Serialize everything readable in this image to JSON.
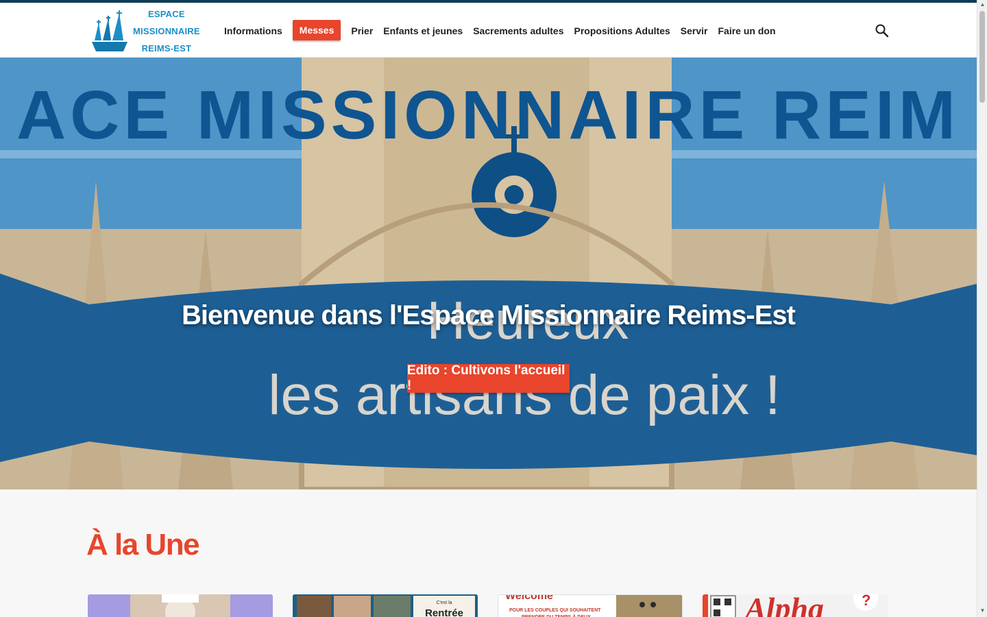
{
  "header": {
    "logo": {
      "line1": "ESPACE",
      "line2": "MISSIONNAIRE",
      "line3": "REIMS-EST"
    },
    "nav": [
      {
        "label": "Informations"
      },
      {
        "label": "Messes",
        "highlight": true
      },
      {
        "label": "Prier"
      },
      {
        "label": "Enfants et jeunes"
      },
      {
        "label": "Sacrements adultes"
      },
      {
        "label": "Propositions Adultes"
      },
      {
        "label": "Servir"
      },
      {
        "label": "Faire un don"
      }
    ],
    "search_icon": "search-icon"
  },
  "hero": {
    "banner_text": "ACE MISSIONNAIRE REIM",
    "ribbon_text_1": "Heureux",
    "ribbon_text_2": "les artisans de paix !",
    "title": "Bienvenue dans l'Espace Missionnaire Reims-Est",
    "button": "Edito : Cultivons l'accueil !"
  },
  "section": {
    "title": "À la Une"
  },
  "cards": [
    {
      "caption": ""
    },
    {
      "caption": "C'est la Rentrée"
    },
    {
      "caption": "Welcome — POUR LES COUPLES QUI SOUHAITENT PRENDRE DU TEMPS À DEUX"
    },
    {
      "caption": "Alpha"
    }
  ],
  "colors": {
    "accent": "#e8452c",
    "brand_blue": "#1b8fc7",
    "dark_navy": "#0d3b57"
  }
}
